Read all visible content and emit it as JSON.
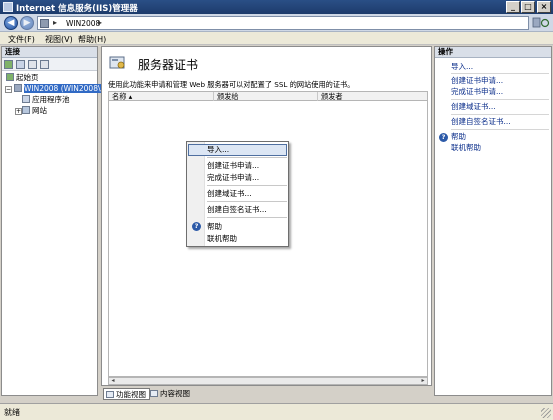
{
  "window": {
    "title": "Internet 信息服务(IIS)管理器"
  },
  "address": {
    "crumbs": [
      "WIN2008"
    ],
    "separator": "▸"
  },
  "menu": {
    "items": [
      "文件(F)",
      "视图(V)",
      "帮助(H)"
    ]
  },
  "connections": {
    "header": "连接",
    "tree": [
      {
        "label": "起始页"
      },
      {
        "label": "WIN2008 (WIN2008\\Ad"
      },
      {
        "label": "应用程序池"
      },
      {
        "label": "网站"
      }
    ]
  },
  "main": {
    "title": "服务器证书",
    "description": "使用此功能来申请和管理 Web 服务器可以对配置了 SSL 的网站使用的证书。",
    "columns": [
      "名称 ▴",
      "颁发给",
      "颁发者"
    ],
    "rows": []
  },
  "context_menu": {
    "items": [
      {
        "label": "导入..."
      },
      {
        "label": "创建证书申请..."
      },
      {
        "label": "完成证书申请..."
      },
      {
        "label": "创建域证书..."
      },
      {
        "label": "创建自签名证书..."
      },
      {
        "label": "帮助"
      },
      {
        "label": "联机帮助"
      }
    ],
    "help_glyph": "?"
  },
  "view_tabs": [
    "功能视图",
    "内容视图"
  ],
  "actions": {
    "header": "操作",
    "items": [
      {
        "label": "导入..."
      },
      {
        "label": "创建证书申请..."
      },
      {
        "label": "完成证书申请..."
      },
      {
        "label": "创建域证书..."
      },
      {
        "label": "创建自签名证书..."
      },
      {
        "label": "帮助"
      },
      {
        "label": "联机帮助"
      }
    ],
    "help_glyph": "?"
  },
  "status": {
    "text": "就绪"
  },
  "colors": {
    "link": "#0a2d8a",
    "title_bar": "#1d3b6b",
    "selection": "#316ac5"
  }
}
